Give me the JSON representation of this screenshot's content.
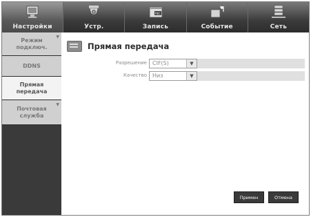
{
  "tabs": [
    {
      "label": "Настройки",
      "icon": "monitor-icon",
      "active": true
    },
    {
      "label": "Устр.",
      "icon": "camera-icon",
      "active": false
    },
    {
      "label": "Запись",
      "icon": "rec-icon",
      "active": false
    },
    {
      "label": "Событие",
      "icon": "event-icon",
      "active": false
    },
    {
      "label": "Сеть",
      "icon": "network-icon",
      "active": false
    }
  ],
  "sidebar": {
    "items": [
      {
        "label": "Режим подключ."
      },
      {
        "label": "DDNS"
      },
      {
        "label": "Прямая передача"
      },
      {
        "label": "Почтовая служба"
      }
    ]
  },
  "panel": {
    "title": "Прямая передача",
    "fields": [
      {
        "label": "Разрешение",
        "value": "CIF(S)"
      },
      {
        "label": "Качество",
        "value": "Низ"
      }
    ]
  },
  "buttons": {
    "apply": "Примен",
    "cancel": "Отмена"
  }
}
